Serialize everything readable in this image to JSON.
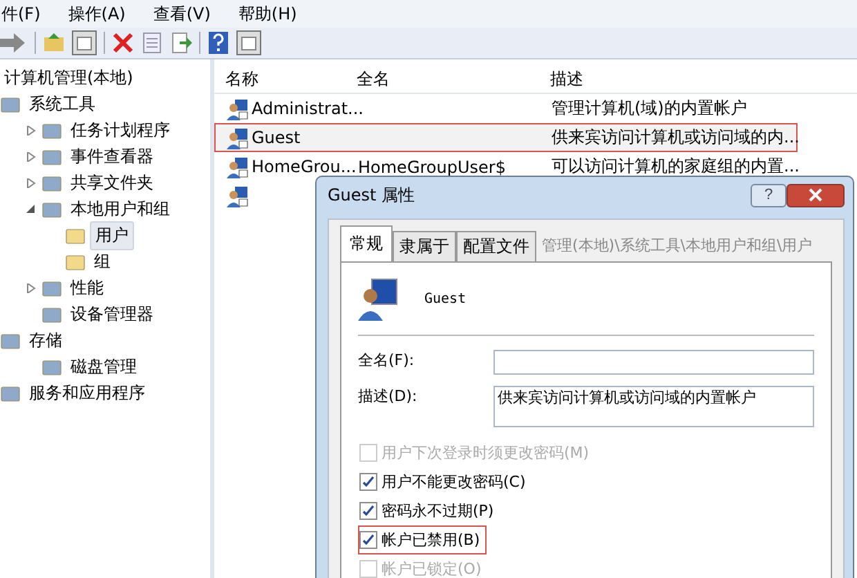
{
  "menu": [
    {
      "label": "件(F)"
    },
    {
      "label": "操作(A)"
    },
    {
      "label": "查看(V)"
    },
    {
      "label": "帮助(H)"
    }
  ],
  "tree": [
    {
      "label": "计算机管理(本地)",
      "selected": false,
      "children": [
        {
          "label": "系统工具",
          "selected": false,
          "children": [
            {
              "label": "任务计划程序",
              "expanded": false,
              "selected": false
            },
            {
              "label": "事件查看器",
              "expanded": false,
              "selected": false
            },
            {
              "label": "共享文件夹",
              "expanded": false,
              "selected": false
            },
            {
              "label": "本地用户和组",
              "expanded": true,
              "selected": false,
              "children": [
                {
                  "label": "用户",
                  "selected": true
                },
                {
                  "label": "组",
                  "selected": false
                }
              ]
            },
            {
              "label": "性能",
              "expanded": false,
              "selected": false
            },
            {
              "label": "设备管理器",
              "selected": false
            }
          ]
        },
        {
          "label": "存储",
          "selected": false,
          "children": [
            {
              "label": "磁盘管理",
              "selected": false
            }
          ]
        },
        {
          "label": "服务和应用程序",
          "selected": false
        }
      ]
    }
  ],
  "table": {
    "columns": [
      "名称",
      "全名",
      "描述"
    ],
    "rows": [
      {
        "cells": [
          "Administrat...",
          "",
          "管理计算机(域)的内置帐户"
        ],
        "highlighted": false
      },
      {
        "cells": [
          "Guest",
          "",
          "供来宾访问计算机或访问域的内..."
        ],
        "highlighted": true
      },
      {
        "cells": [
          "HomeGrou...",
          "HomeGroupUser$",
          "可以访问计算机的家庭组的内置..."
        ],
        "highlighted": false
      },
      {
        "cells": [
          "",
          "",
          ""
        ],
        "highlighted": false
      }
    ]
  },
  "dialog": {
    "title": "Guest 属性",
    "help": "?",
    "tabs": [
      {
        "label": "常规",
        "selected": true
      },
      {
        "label": "隶属于",
        "selected": false
      },
      {
        "label": "配置文件",
        "selected": false
      }
    ],
    "tooltip": "管理(本地)\\系统工具\\本地用户和组\\用户",
    "user_name": "Guest",
    "fields": [
      {
        "label": "全名(F):",
        "kind": "line"
      },
      {
        "label": "描述(D):",
        "value": "供来宾访问计算机或访问域的内置帐户",
        "kind": "area"
      }
    ],
    "checkboxes": [
      {
        "label": "用户下次登录时须更改密码(M)",
        "checked": false,
        "disabled": true,
        "highlighted": false
      },
      {
        "label": "用户不能更改密码(C)",
        "checked": true,
        "disabled": false,
        "highlighted": false
      },
      {
        "label": "密码永不过期(P)",
        "checked": true,
        "disabled": false,
        "highlighted": false
      },
      {
        "label": "帐户已禁用(B)",
        "checked": true,
        "disabled": false,
        "highlighted": true
      },
      {
        "label": "帐户已锁定(O)",
        "checked": false,
        "disabled": true,
        "highlighted": false
      }
    ]
  }
}
